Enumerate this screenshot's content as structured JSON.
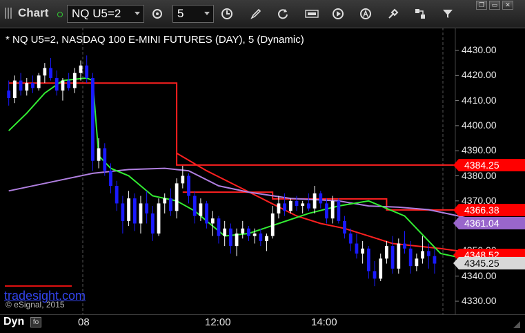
{
  "toolbar": {
    "app_title": "Chart",
    "symbol": "NQ U5=2",
    "interval": "5"
  },
  "chart_data": {
    "type": "candlestick",
    "title": "* NQ U5=2, NASDAQ 100 E-MINI FUTURES (DAY), 5 (Dynamic)",
    "y_ticks": [
      "4430.00",
      "4420.00",
      "4410.00",
      "4400.00",
      "4390.00",
      "4380.00",
      "4370.00",
      "4360.00",
      "4350.00",
      "4340.00",
      "4330.00"
    ],
    "ylim": [
      4325,
      4437
    ],
    "x_ticks": [
      "08",
      "12:00",
      "14:00"
    ],
    "price_tags": [
      {
        "value": 4384.25,
        "label": "4384.25",
        "color": "#ff0000",
        "text_color": "#ffffff"
      },
      {
        "value": 4366.38,
        "label": "4366.38",
        "color": "#ff0000",
        "text_color": "#ffffff"
      },
      {
        "value": 4361.04,
        "label": "4361.04",
        "color": "#9966cc",
        "text_color": "#ffffff"
      },
      {
        "value": 4348.52,
        "label": "4348.52",
        "color": "#ff0000",
        "text_color": "#ffffff"
      },
      {
        "value": 4345.25,
        "label": "4345.25",
        "color": "#d8d8d8",
        "text_color": "#000000"
      }
    ],
    "overlays": [
      {
        "type": "step",
        "color": "#ff2020",
        "points": [
          [
            0,
            4417
          ],
          [
            28,
            4417
          ],
          [
            28,
            4384.3
          ],
          [
            80,
            4384.3
          ]
        ]
      },
      {
        "type": "step",
        "color": "#ff2020",
        "points": [
          [
            29,
            4373.5
          ],
          [
            44,
            4373.5
          ],
          [
            44,
            4370.8
          ],
          [
            63,
            4370.8
          ],
          [
            63,
            4366.4
          ],
          [
            80,
            4366.4
          ]
        ]
      },
      {
        "type": "line",
        "color": "#ff2020",
        "points": [
          [
            28,
            4389
          ],
          [
            33,
            4382
          ],
          [
            38,
            4376
          ],
          [
            43,
            4370
          ],
          [
            48,
            4364
          ],
          [
            52,
            4361
          ],
          [
            56,
            4359
          ],
          [
            60,
            4356
          ],
          [
            64,
            4353
          ],
          [
            68,
            4352
          ],
          [
            72,
            4351
          ],
          [
            75,
            4350
          ],
          [
            78,
            4349.5
          ],
          [
            80,
            4348.5
          ]
        ]
      },
      {
        "type": "line",
        "color": "#b07fe0",
        "points": [
          [
            0,
            4374
          ],
          [
            8,
            4378
          ],
          [
            14,
            4381
          ],
          [
            20,
            4382.5
          ],
          [
            26,
            4383
          ],
          [
            30,
            4382
          ],
          [
            35,
            4376
          ],
          [
            40,
            4373.5
          ],
          [
            47,
            4371
          ],
          [
            55,
            4370
          ],
          [
            60,
            4368
          ],
          [
            65,
            4367.5
          ],
          [
            70,
            4366.5
          ],
          [
            75,
            4364
          ],
          [
            80,
            4361
          ]
        ]
      },
      {
        "type": "line",
        "color": "#33ee33",
        "points": [
          [
            0,
            4398
          ],
          [
            3,
            4405
          ],
          [
            6,
            4413
          ],
          [
            9,
            4418
          ],
          [
            13,
            4419
          ],
          [
            14,
            4418
          ],
          [
            15,
            4388
          ],
          [
            17,
            4383
          ],
          [
            20,
            4380
          ],
          [
            24,
            4372
          ],
          [
            28,
            4370
          ],
          [
            31,
            4366
          ],
          [
            34,
            4360
          ],
          [
            36,
            4356
          ],
          [
            40,
            4357
          ],
          [
            45,
            4361
          ],
          [
            50,
            4365
          ],
          [
            55,
            4368
          ],
          [
            60,
            4370
          ],
          [
            66,
            4364
          ],
          [
            70,
            4354
          ],
          [
            72,
            4349
          ],
          [
            76,
            4347
          ],
          [
            80,
            4348
          ]
        ]
      }
    ],
    "candles": [
      {
        "o": 4414,
        "h": 4418,
        "l": 4408,
        "c": 4411
      },
      {
        "o": 4411,
        "h": 4420,
        "l": 4409,
        "c": 4418
      },
      {
        "o": 4418,
        "h": 4421,
        "l": 4412,
        "c": 4414
      },
      {
        "o": 4414,
        "h": 4419,
        "l": 4412,
        "c": 4417
      },
      {
        "o": 4417,
        "h": 4420,
        "l": 4413,
        "c": 4415
      },
      {
        "o": 4415,
        "h": 4421,
        "l": 4414,
        "c": 4420
      },
      {
        "o": 4420,
        "h": 4425,
        "l": 4417,
        "c": 4423
      },
      {
        "o": 4423,
        "h": 4427,
        "l": 4418,
        "c": 4419
      },
      {
        "o": 4419,
        "h": 4422,
        "l": 4412,
        "c": 4414
      },
      {
        "o": 4414,
        "h": 4419,
        "l": 4410,
        "c": 4418
      },
      {
        "o": 4418,
        "h": 4421,
        "l": 4414,
        "c": 4415
      },
      {
        "o": 4415,
        "h": 4423,
        "l": 4413,
        "c": 4421
      },
      {
        "o": 4421,
        "h": 4426,
        "l": 4418,
        "c": 4424
      },
      {
        "o": 4424,
        "h": 4428,
        "l": 4417,
        "c": 4419
      },
      {
        "o": 4419,
        "h": 4421,
        "l": 4382,
        "c": 4386
      },
      {
        "o": 4386,
        "h": 4395,
        "l": 4383,
        "c": 4391
      },
      {
        "o": 4391,
        "h": 4393,
        "l": 4380,
        "c": 4382
      },
      {
        "o": 4382,
        "h": 4385,
        "l": 4373,
        "c": 4376
      },
      {
        "o": 4376,
        "h": 4378,
        "l": 4366,
        "c": 4369
      },
      {
        "o": 4369,
        "h": 4372,
        "l": 4357,
        "c": 4362
      },
      {
        "o": 4362,
        "h": 4374,
        "l": 4360,
        "c": 4371
      },
      {
        "o": 4371,
        "h": 4373,
        "l": 4358,
        "c": 4361
      },
      {
        "o": 4361,
        "h": 4372,
        "l": 4357,
        "c": 4369
      },
      {
        "o": 4369,
        "h": 4374,
        "l": 4361,
        "c": 4365
      },
      {
        "o": 4365,
        "h": 4368,
        "l": 4354,
        "c": 4357
      },
      {
        "o": 4357,
        "h": 4371,
        "l": 4356,
        "c": 4369
      },
      {
        "o": 4369,
        "h": 4373,
        "l": 4365,
        "c": 4371
      },
      {
        "o": 4371,
        "h": 4375,
        "l": 4364,
        "c": 4366
      },
      {
        "o": 4366,
        "h": 4379,
        "l": 4363,
        "c": 4377
      },
      {
        "o": 4377,
        "h": 4384,
        "l": 4375,
        "c": 4380
      },
      {
        "o": 4380,
        "h": 4381,
        "l": 4369,
        "c": 4372
      },
      {
        "o": 4372,
        "h": 4374,
        "l": 4361,
        "c": 4364
      },
      {
        "o": 4364,
        "h": 4371,
        "l": 4362,
        "c": 4369
      },
      {
        "o": 4369,
        "h": 4370,
        "l": 4359,
        "c": 4361
      },
      {
        "o": 4361,
        "h": 4366,
        "l": 4356,
        "c": 4363
      },
      {
        "o": 4363,
        "h": 4364,
        "l": 4353,
        "c": 4356
      },
      {
        "o": 4356,
        "h": 4362,
        "l": 4352,
        "c": 4359
      },
      {
        "o": 4359,
        "h": 4361,
        "l": 4349,
        "c": 4352
      },
      {
        "o": 4352,
        "h": 4359,
        "l": 4348,
        "c": 4357
      },
      {
        "o": 4357,
        "h": 4362,
        "l": 4355,
        "c": 4359
      },
      {
        "o": 4359,
        "h": 4360,
        "l": 4354,
        "c": 4356
      },
      {
        "o": 4356,
        "h": 4359,
        "l": 4353,
        "c": 4357
      },
      {
        "o": 4357,
        "h": 4359,
        "l": 4352,
        "c": 4354
      },
      {
        "o": 4354,
        "h": 4357,
        "l": 4350,
        "c": 4356
      },
      {
        "o": 4356,
        "h": 4368,
        "l": 4355,
        "c": 4365
      },
      {
        "o": 4365,
        "h": 4372,
        "l": 4363,
        "c": 4369
      },
      {
        "o": 4369,
        "h": 4373,
        "l": 4364,
        "c": 4366
      },
      {
        "o": 4366,
        "h": 4371,
        "l": 4365,
        "c": 4370
      },
      {
        "o": 4370,
        "h": 4372,
        "l": 4366,
        "c": 4368
      },
      {
        "o": 4368,
        "h": 4370,
        "l": 4365,
        "c": 4369
      },
      {
        "o": 4369,
        "h": 4373,
        "l": 4366,
        "c": 4367
      },
      {
        "o": 4367,
        "h": 4376,
        "l": 4365,
        "c": 4373
      },
      {
        "o": 4373,
        "h": 4374,
        "l": 4367,
        "c": 4369
      },
      {
        "o": 4369,
        "h": 4371,
        "l": 4361,
        "c": 4363
      },
      {
        "o": 4363,
        "h": 4372,
        "l": 4361,
        "c": 4370
      },
      {
        "o": 4370,
        "h": 4371,
        "l": 4361,
        "c": 4362
      },
      {
        "o": 4362,
        "h": 4364,
        "l": 4355,
        "c": 4357
      },
      {
        "o": 4357,
        "h": 4359,
        "l": 4350,
        "c": 4353
      },
      {
        "o": 4353,
        "h": 4357,
        "l": 4347,
        "c": 4349
      },
      {
        "o": 4349,
        "h": 4354,
        "l": 4345,
        "c": 4351
      },
      {
        "o": 4351,
        "h": 4352,
        "l": 4339,
        "c": 4342
      },
      {
        "o": 4342,
        "h": 4346,
        "l": 4336,
        "c": 4339
      },
      {
        "o": 4339,
        "h": 4349,
        "l": 4338,
        "c": 4347
      },
      {
        "o": 4347,
        "h": 4354,
        "l": 4345,
        "c": 4352
      },
      {
        "o": 4352,
        "h": 4356,
        "l": 4341,
        "c": 4343
      },
      {
        "o": 4343,
        "h": 4355,
        "l": 4341,
        "c": 4353
      },
      {
        "o": 4353,
        "h": 4358,
        "l": 4349,
        "c": 4351
      },
      {
        "o": 4351,
        "h": 4354,
        "l": 4341,
        "c": 4344
      },
      {
        "o": 4344,
        "h": 4349,
        "l": 4342,
        "c": 4347
      },
      {
        "o": 4347,
        "h": 4356,
        "l": 4345,
        "c": 4350
      },
      {
        "o": 4350,
        "h": 4353,
        "l": 4343,
        "c": 4348
      },
      {
        "o": 4348,
        "h": 4351,
        "l": 4341,
        "c": 4345
      }
    ]
  },
  "watermark": "tradesight.com",
  "copyright": "© eSignal, 2015",
  "bottom": {
    "mode_label": "Dyn"
  }
}
